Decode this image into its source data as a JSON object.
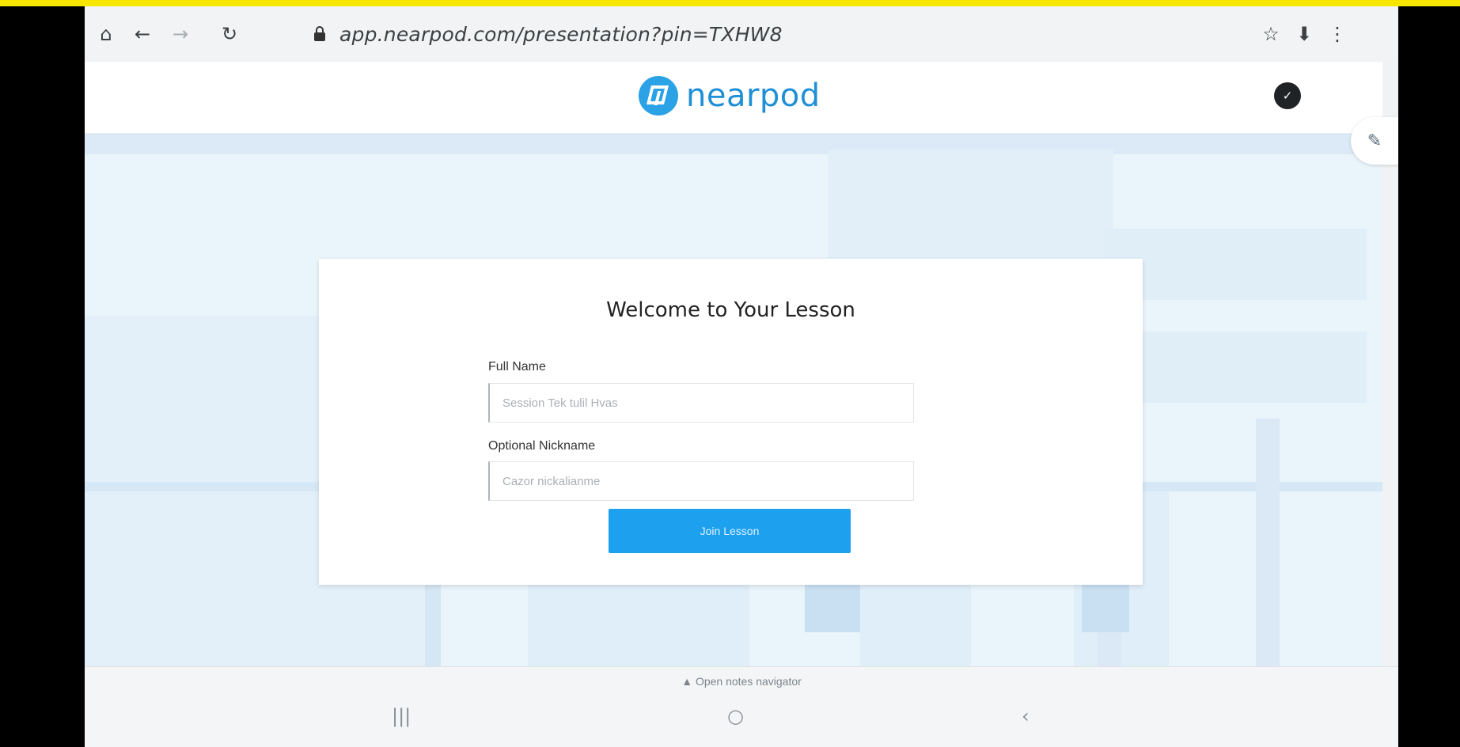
{
  "browser": {
    "url": "app.nearpod.com/presentation?pin=TXHW8",
    "icons": [
      "home-icon",
      "back-icon",
      "forward-icon",
      "reload-icon",
      "lock-icon",
      "star-icon",
      "download-icon",
      "more-icon"
    ]
  },
  "header": {
    "brand": "nearpod"
  },
  "card": {
    "title": "Welcome to Your Lesson",
    "full_name_label": "Full Name",
    "full_name_placeholder": "Session Tek tulil Hvas",
    "nickname_label": "Optional Nickname",
    "nickname_placeholder": "Cazor nickalianme",
    "join_label": "Join Lesson"
  },
  "bottom": {
    "open_notes": "Open notes navigator"
  },
  "colors": {
    "accent": "#1da1ee",
    "brand": "#2ba1e6",
    "background": "#eaf4fb",
    "outer_highlight": "#f6e600"
  }
}
